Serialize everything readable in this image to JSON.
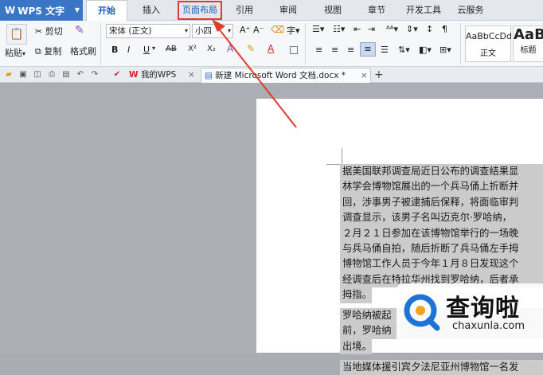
{
  "app": {
    "title": "WPS 文字"
  },
  "menu": {
    "tabs": [
      "开始",
      "插入",
      "页面布局",
      "引用",
      "审阅",
      "视图",
      "章节",
      "开发工具",
      "云服务"
    ],
    "active": "开始",
    "highlighted": "页面布局"
  },
  "ribbon": {
    "clipboard": {
      "paste": "粘贴",
      "cut": "剪切",
      "copy": "复制",
      "format_painter": "格式刷"
    },
    "font": {
      "name": "宋体 (正文)",
      "size": "小四",
      "grow": "A⁺",
      "shrink": "A⁻",
      "bold": "B",
      "italic": "I",
      "underline": "U",
      "strike": "AB",
      "superscript": "X²",
      "subscript": "X₂",
      "font_color": "A"
    },
    "styles": [
      {
        "preview": "AaBbCcDd",
        "label": "正文"
      },
      {
        "preview": "AaB",
        "label": "标题"
      }
    ]
  },
  "doc_tabs": [
    {
      "label": "我的WPS",
      "close": "×"
    },
    {
      "label": "新建 Microsoft Word 文档.docx *",
      "close": "×"
    }
  ],
  "new_tab": "+",
  "document": {
    "lines": [
      "据美国联邦调查局近日公布的调查结果显",
      "林学会博物馆展出的一个兵马俑上折断并",
      "回，涉事男子被逮捕后保释，将面临审判",
      "调查显示，该男子名叫迈克尔·罗哈纳，",
      "２月２１日参加在该博物馆举行的一场晚",
      "与兵马俑自拍，随后折断了兵马俑左手拇",
      "博物馆工作人员于今年１月８日发现这个",
      "经调查后在特拉华州找到罗哈纳，后者承",
      "拇指。",
      "罗哈纳被起",
      "前，罗哈纳",
      "出境。",
      "当地媒体援引宾夕法尼亚州博物馆一名发"
    ]
  },
  "watermark": {
    "brand": "查询啦",
    "url": "chaxunla.com"
  },
  "colors": {
    "accent": "#3a76c6",
    "annotation": "#e23a2e"
  }
}
